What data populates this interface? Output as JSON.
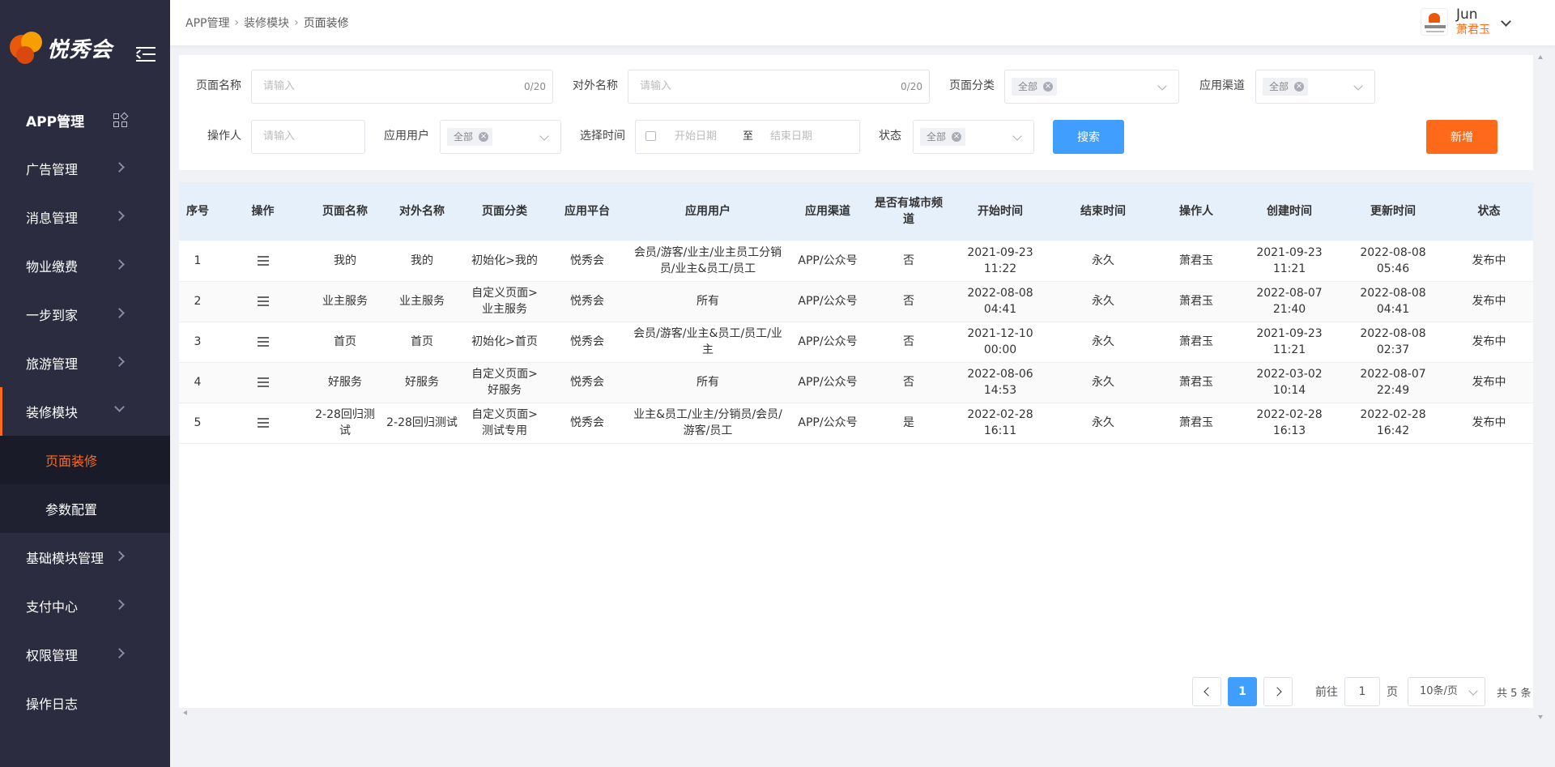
{
  "sidebar": {
    "logo_text": "悦秀会",
    "items": [
      {
        "label": "APP管理"
      },
      {
        "label": "广告管理"
      },
      {
        "label": "消息管理"
      },
      {
        "label": "物业缴费"
      },
      {
        "label": "一步到家"
      },
      {
        "label": "旅游管理"
      },
      {
        "label": "装修模块"
      },
      {
        "label": "基础模块管理"
      },
      {
        "label": "支付中心"
      },
      {
        "label": "权限管理"
      },
      {
        "label": "操作日志"
      }
    ],
    "subitems": [
      {
        "label": "页面装修"
      },
      {
        "label": "参数配置"
      }
    ]
  },
  "header": {
    "breadcrumb": [
      "APP管理",
      "装修模块",
      "页面装修"
    ],
    "user_name": "Jun",
    "user_role": "萧君玉"
  },
  "filters": {
    "page_name_label": "页面名称",
    "page_name_placeholder": "请输入",
    "page_name_count": "0/20",
    "external_name_label": "对外名称",
    "external_name_placeholder": "请输入",
    "external_name_count": "0/20",
    "category_label": "页面分类",
    "category_value": "全部",
    "channel_label": "应用渠道",
    "channel_value": "全部",
    "operator_label": "操作人",
    "operator_placeholder": "请输入",
    "app_user_label": "应用用户",
    "app_user_value": "全部",
    "time_label": "选择时间",
    "start_placeholder": "开始日期",
    "range_sep": "至",
    "end_placeholder": "结束日期",
    "status_label": "状态",
    "status_value": "全部",
    "search_button": "搜索",
    "add_button": "新增"
  },
  "table": {
    "columns": [
      "序号",
      "操作",
      "页面名称",
      "对外名称",
      "页面分类",
      "应用平台",
      "应用用户",
      "应用渠道",
      "是否有城市频道",
      "开始时间",
      "结束时间",
      "操作人",
      "创建时间",
      "更新时间",
      "状态"
    ],
    "rows": [
      [
        "1",
        "",
        "我的",
        "我的",
        "初始化>我的",
        "悦秀会",
        "会员/游客/业主/业主员工分销员/业主&员工/员工",
        "APP/公众号",
        "否",
        "2021-09-23 11:22",
        "永久",
        "萧君玉",
        "2021-09-23 11:21",
        "2022-08-08 05:46",
        "发布中"
      ],
      [
        "2",
        "",
        "业主服务",
        "业主服务",
        "自定义页面>业主服务",
        "悦秀会",
        "所有",
        "APP/公众号",
        "否",
        "2022-08-08 04:41",
        "永久",
        "萧君玉",
        "2022-08-07 21:40",
        "2022-08-08 04:41",
        "发布中"
      ],
      [
        "3",
        "",
        "首页",
        "首页",
        "初始化>首页",
        "悦秀会",
        "会员/游客/业主&员工/员工/业主",
        "APP/公众号",
        "否",
        "2021-12-10 00:00",
        "永久",
        "萧君玉",
        "2021-09-23 11:21",
        "2022-08-08 02:37",
        "发布中"
      ],
      [
        "4",
        "",
        "好服务",
        "好服务",
        "自定义页面>好服务",
        "悦秀会",
        "所有",
        "APP/公众号",
        "否",
        "2022-08-06 14:53",
        "永久",
        "萧君玉",
        "2022-03-02 10:14",
        "2022-08-07 22:49",
        "发布中"
      ],
      [
        "5",
        "",
        "2-28回归测试",
        "2-28回归测试",
        "自定义页面>测试专用",
        "悦秀会",
        "业主&员工/业主/分销员/会员/游客/员工",
        "APP/公众号",
        "是",
        "2022-02-28 16:11",
        "永久",
        "萧君玉",
        "2022-02-28 16:13",
        "2022-02-28 16:42",
        "发布中"
      ]
    ]
  },
  "pagination": {
    "current": "1",
    "goto_label": "前往",
    "goto_value": "1",
    "page_unit": "页",
    "page_size": "10条/页",
    "total": "共 5 条"
  }
}
